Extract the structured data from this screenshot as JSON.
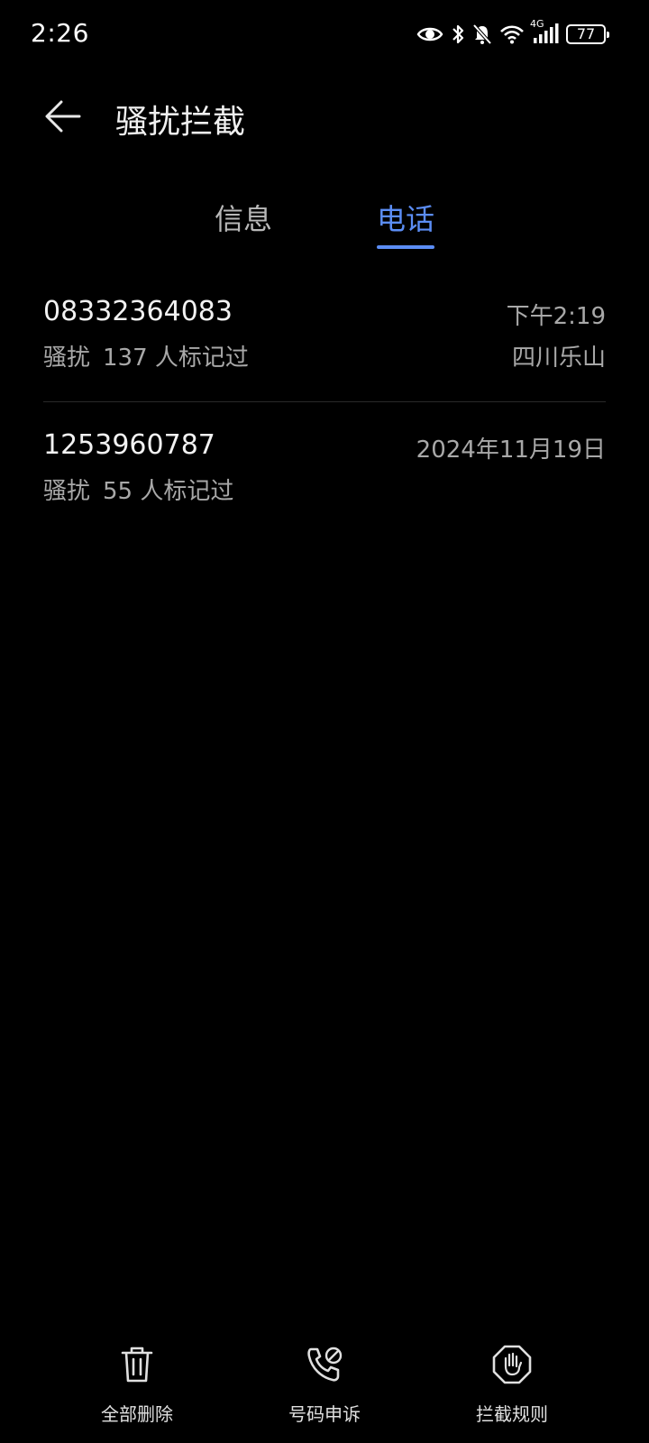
{
  "status_bar": {
    "time": "2:26",
    "network": "4G",
    "battery": "77",
    "icons": [
      "eye-icon",
      "bluetooth-icon",
      "mute-bell-icon",
      "wifi-icon",
      "signal-icon",
      "battery-icon"
    ]
  },
  "header": {
    "title": "骚扰拦截",
    "back_icon": "arrow-left-icon"
  },
  "tabs": [
    {
      "label": "信息",
      "active": false
    },
    {
      "label": "电话",
      "active": true
    }
  ],
  "calls": [
    {
      "number": "08332364083",
      "time": "下午2:19",
      "tag": "骚扰",
      "count_text": "137 人标记过",
      "location": "四川乐山"
    },
    {
      "number": "1253960787",
      "time": "2024年11月19日",
      "tag": "骚扰",
      "count_text": "55 人标记过",
      "location": ""
    }
  ],
  "actions": [
    {
      "label": "全部删除",
      "icon": "trash-icon"
    },
    {
      "label": "号码申诉",
      "icon": "phone-appeal-icon"
    },
    {
      "label": "拦截规则",
      "icon": "hand-stop-icon"
    }
  ],
  "colors": {
    "background": "#000000",
    "accent": "#5b8df5",
    "primary_text": "#f2f2f2",
    "secondary_text": "#a8a8a8"
  }
}
